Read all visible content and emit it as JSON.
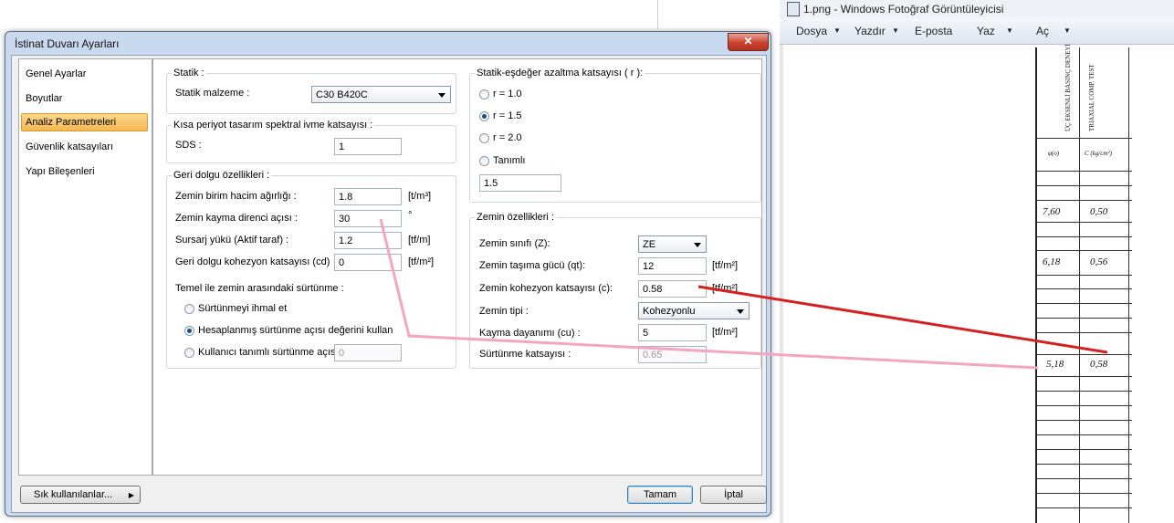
{
  "viewer": {
    "title": "1.png - Windows Fotoğraf Görüntüleyicisi",
    "menu": [
      "Dosya",
      "Yazdır",
      "E-posta",
      "Yaz",
      "Aç"
    ],
    "scan": {
      "header_col1": "ÜÇ EKSENLİ BASINÇ DENEYİ",
      "header_col2": "TRIAXIAL COMP. TEST",
      "col_labels": [
        "φ(o)",
        "C (kg/cm²)"
      ],
      "rows": [
        {
          "phi": "7,60",
          "c": "0,50"
        },
        {
          "phi": "6,18",
          "c": "0,56"
        },
        {
          "phi": "5,18",
          "c": "0,58"
        }
      ]
    }
  },
  "dialog": {
    "title": "İstinat Duvarı Ayarları",
    "close_label": "✕",
    "nav": [
      "Genel Ayarlar",
      "Boyutlar",
      "Analiz Parametreleri",
      "Güvenlik katsayıları",
      "Yapı Bileşenleri"
    ],
    "selected_nav": "Analiz Parametreleri",
    "statik": {
      "title": "Statik :",
      "label": "Statik malzeme :",
      "value": "C30 B420C"
    },
    "kisa": {
      "title": "Kısa periyot tasarım spektral ivme katsayısı :",
      "label": "SDS :",
      "value": "1"
    },
    "geri": {
      "title": "Geri dolgu özellikleri :",
      "rows": [
        {
          "label": "Zemin birim hacim ağırlığı :",
          "value": "1.8",
          "unit": "[t/m³]"
        },
        {
          "label": "Zemin kayma direnci açısı :",
          "value": "30",
          "unit": "°"
        },
        {
          "label": "Sursarj yükü (Aktif taraf) :",
          "value": "1.2",
          "unit": "[tf/m]"
        },
        {
          "label": "Geri dolgu kohezyon katsayısı (cd)",
          "value": "0",
          "unit": "[tf/m²]"
        }
      ],
      "friction_title": "Temel ile zemin arasındaki sürtünme :",
      "friction_options": [
        "Sürtünmeyi ihmal et",
        "Hesaplanmış sürtünme açısı değerini kullan",
        "Kullanıcı tanımlı sürtünme açısı :"
      ],
      "friction_selected": 1,
      "friction_value": "0"
    },
    "azaltma": {
      "title": "Statik-eşdeğer azaltma katsayısı ( r ):",
      "options": [
        "r = 1.0",
        "r = 1.5",
        "r = 2.0",
        "Tanımlı"
      ],
      "selected": 1,
      "value": "1.5"
    },
    "zemin": {
      "title": "Zemin özellikleri :",
      "sinif_label": "Zemin sınıfı (Z):",
      "sinif_value": "ZE",
      "tasima_label": "Zemin taşıma gücü (qt):",
      "tasima_value": "12",
      "tasima_unit": "[tf/m²]",
      "kohezyon_label": "Zemin kohezyon katsayısı (c):",
      "kohezyon_value": "0.58",
      "kohezyon_unit": "[tf/m²]",
      "tip_label": "Zemin tipi :",
      "tip_value": "Kohezyonlu",
      "kayma_label": "Kayma dayanımı (cu) :",
      "kayma_value": "5",
      "kayma_unit": "[tf/m²]",
      "surtunme_label": "Sürtünme katsayısı :",
      "surtunme_value": "0.65"
    },
    "footer": {
      "sik": "Sık kullanılanlar...",
      "ok": "Tamam",
      "cancel": "İptal"
    }
  },
  "annotations": {
    "red_color": "#d62020",
    "pink_color": "#f4a6c0"
  }
}
